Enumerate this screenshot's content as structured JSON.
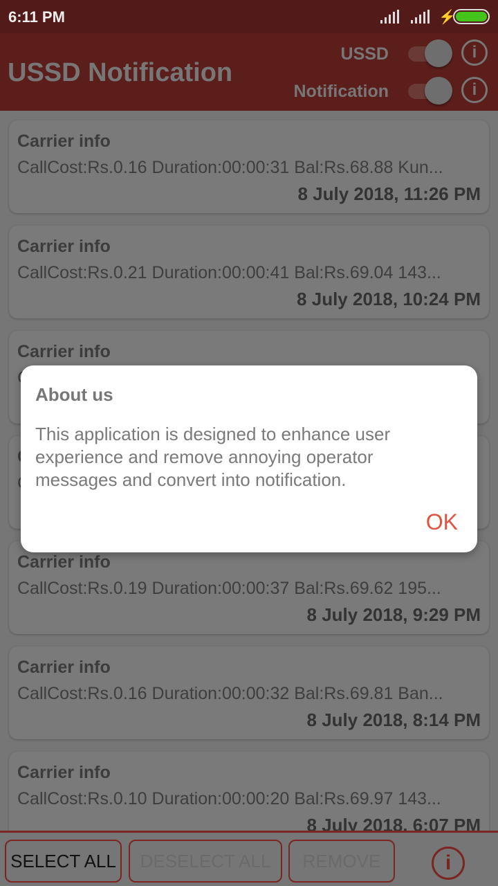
{
  "status_bar": {
    "time": "6:11 PM",
    "battery_color": "#44c41a"
  },
  "header": {
    "title": "USSD Notification",
    "ussd_label": "USSD",
    "notification_label": "Notification",
    "ussd_on": true,
    "notification_on": true,
    "color": "#5c1e1b"
  },
  "items": [
    {
      "title": "Carrier info",
      "body": "CallCost:Rs.0.16 Duration:00:00:31 Bal:Rs.68.88 Kun...",
      "date": "8 July 2018, 11:26 PM"
    },
    {
      "title": "Carrier info",
      "body": "CallCost:Rs.0.21 Duration:00:00:41 Bal:Rs.69.04 143...",
      "date": "8 July 2018, 10:24 PM"
    },
    {
      "title": "Carrier info",
      "body": "C",
      "date": ""
    },
    {
      "title": "C",
      "body": "C",
      "date": ""
    },
    {
      "title": "Carrier info",
      "body": "CallCost:Rs.0.19 Duration:00:00:37 Bal:Rs.69.62 195...",
      "date": "8 July 2018, 9:29 PM"
    },
    {
      "title": "Carrier info",
      "body": "CallCost:Rs.0.16 Duration:00:00:32 Bal:Rs.69.81 Ban...",
      "date": "8 July 2018, 8:14 PM"
    },
    {
      "title": "Carrier info",
      "body": "CallCost:Rs.0.10 Duration:00:00:20 Bal:Rs.69.97 143...",
      "date": "8 July 2018, 6:07 PM"
    }
  ],
  "bottom": {
    "select_all": "SELECT ALL",
    "deselect_all": "DESELECT ALL",
    "remove": "REMOVE"
  },
  "dialog": {
    "title": "About us",
    "body": "This application is designed to enhance user experience and remove annoying operator messages and convert into notification.",
    "ok": "OK",
    "ok_color": "#e0533f"
  }
}
